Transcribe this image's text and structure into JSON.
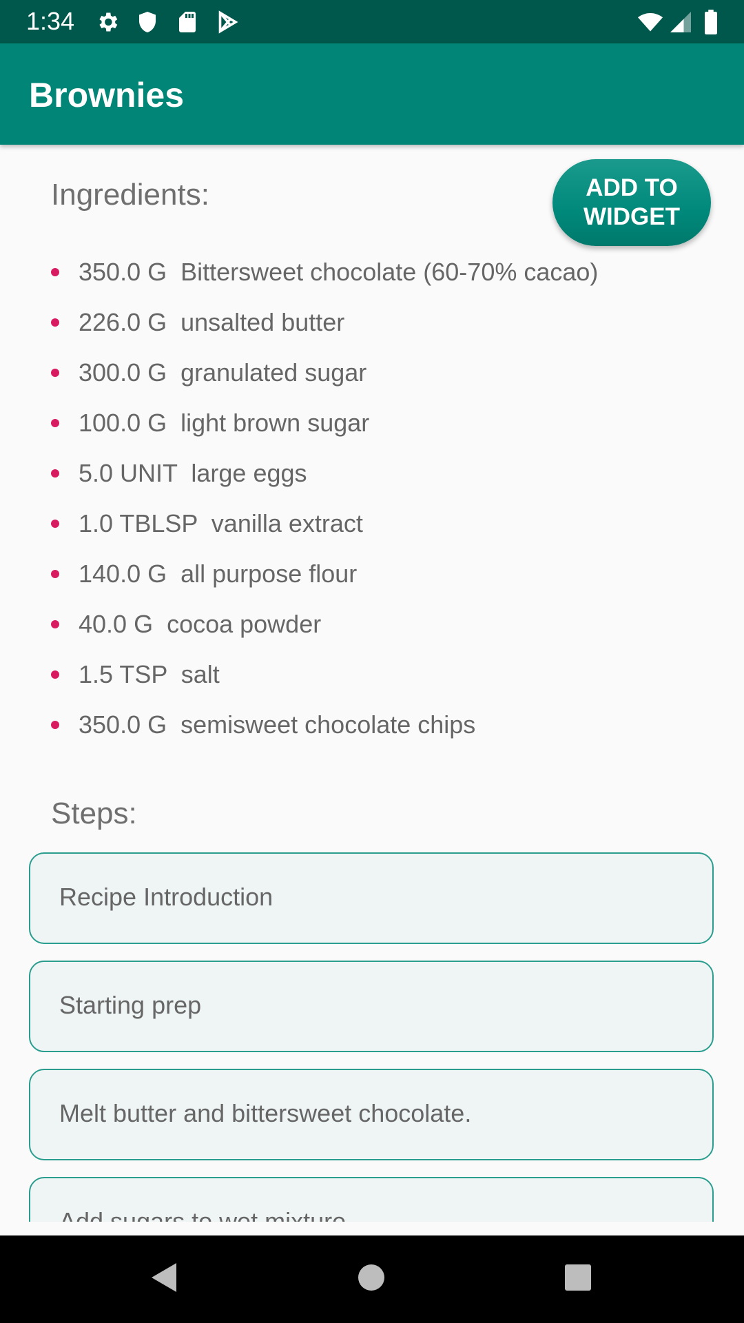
{
  "status_bar": {
    "time": "1:34",
    "left_icons": [
      "gear-icon",
      "shield-icon",
      "sd-card-icon",
      "play-store-icon"
    ],
    "right_icons": [
      "wifi-icon",
      "signal-icon",
      "battery-icon"
    ]
  },
  "app_bar": {
    "title": "Brownies"
  },
  "ingredients": {
    "heading": "Ingredients:",
    "widget_button": {
      "line1": "ADD TO",
      "line2": "WIDGET"
    },
    "bullet_color": "#d81b60",
    "items": [
      "350.0 G  Bittersweet chocolate (60-70% cacao)",
      "226.0 G  unsalted butter",
      "300.0 G  granulated sugar",
      "100.0 G  light brown sugar",
      "5.0 UNIT  large eggs",
      "1.0 TBLSP  vanilla extract",
      "140.0 G  all purpose flour",
      "40.0 G  cocoa powder",
      "1.5 TSP  salt",
      "350.0 G  semisweet chocolate chips"
    ]
  },
  "steps": {
    "heading": "Steps:",
    "items": [
      "Recipe Introduction",
      "Starting prep",
      "Melt butter and bittersweet chocolate.",
      "Add sugars to wet mixture."
    ]
  },
  "colors": {
    "status_bar": "#00574b",
    "app_bar": "#008577",
    "accent": "#d81b60",
    "card_border": "#2a9d8f",
    "card_fill": "#eef5f4"
  },
  "nav_bar": {
    "buttons": [
      "back-icon",
      "home-icon",
      "recents-icon"
    ]
  }
}
